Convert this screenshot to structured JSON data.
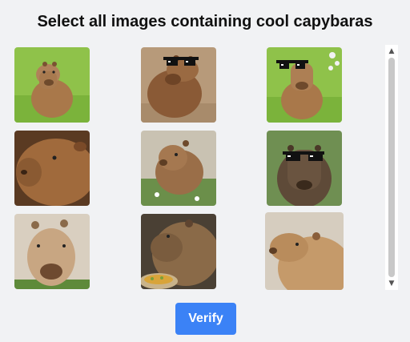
{
  "title": "Select all images containing cool capybaras",
  "verify_label": "Verify",
  "scrollbar": {
    "up_arrow": "▲",
    "down_arrow": "▼"
  },
  "tiles": [
    {
      "subject": "capybara-on-grass",
      "sunglasses": false
    },
    {
      "subject": "capybara-with-sunglasses",
      "sunglasses": true
    },
    {
      "subject": "capybara-with-sunglasses-on-grass",
      "sunglasses": true
    },
    {
      "subject": "capybara-side-profile",
      "sunglasses": false
    },
    {
      "subject": "capybara-in-garden",
      "sunglasses": false
    },
    {
      "subject": "capybara-with-sunglasses-front",
      "sunglasses": true
    },
    {
      "subject": "capybara-closeup-face",
      "sunglasses": false
    },
    {
      "subject": "capybara-with-food-bowl",
      "sunglasses": false
    },
    {
      "subject": "capybara-side-view",
      "sunglasses": false
    }
  ],
  "colors": {
    "accent": "#3b82f6",
    "background": "#f1f2f4"
  }
}
